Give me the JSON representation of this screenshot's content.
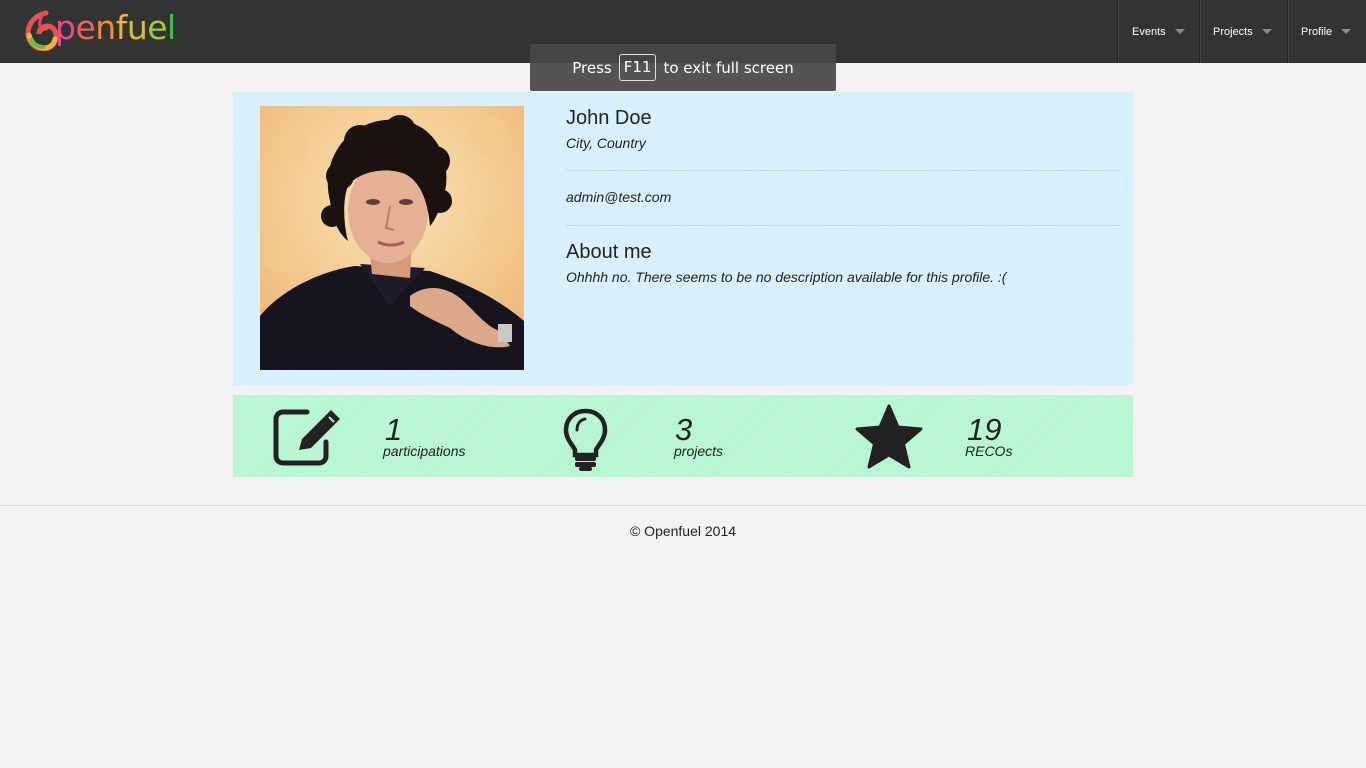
{
  "header": {
    "brand": "openfuel",
    "brand_letters": [
      "o",
      "p",
      "e",
      "n",
      "f",
      "u",
      "e",
      "l"
    ],
    "nav": {
      "events": "Events",
      "projects": "Projects",
      "profile": "Profile"
    }
  },
  "fullscreen_toast": {
    "prefix": "Press",
    "key": "F11",
    "suffix": "to exit full screen"
  },
  "profile": {
    "photo_icon": "profile-photo",
    "name": "John Doe",
    "location": "City, Country",
    "email": "admin@test.com",
    "about_title": "About me",
    "about_text": "Ohhhh no. There seems to be no description available for this profile. :("
  },
  "stats": {
    "participations": {
      "value": "1",
      "label": "participations",
      "icon": "edit-icon"
    },
    "projects": {
      "value": "3",
      "label": "projects",
      "icon": "lightbulb-icon"
    },
    "recos": {
      "value": "19",
      "label": "RECOs",
      "icon": "star-icon"
    }
  },
  "footer": {
    "copyright": "© Openfuel 2014"
  },
  "colors": {
    "topbar": "#333333",
    "profile_panel": "#d5eefb",
    "stats_panel": "#b3f5cf",
    "page_bg": "#f3f3f3"
  }
}
